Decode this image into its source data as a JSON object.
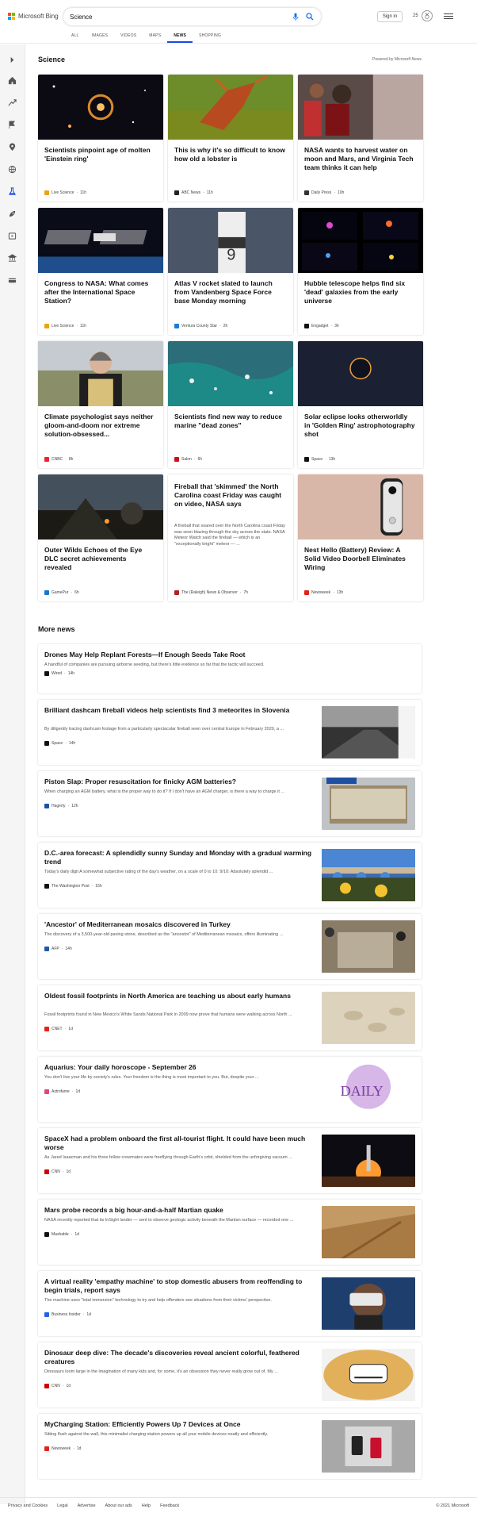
{
  "brand": {
    "logo_text": "Microsoft Bing",
    "logo_colors": [
      "#f25022",
      "#7fba00",
      "#00a4ef",
      "#ffb900"
    ]
  },
  "search": {
    "query": "Science",
    "mic_icon": "mic-icon",
    "search_icon": "search-icon"
  },
  "header": {
    "signin_label": "Sign in",
    "rewards_count": "25",
    "menu_icon": "hamburger-icon"
  },
  "tabs": [
    "ALL",
    "IMAGES",
    "VIDEOS",
    "MAPS",
    "NEWS",
    "SHOPPING"
  ],
  "active_tab": "NEWS",
  "accent": "#174ae4",
  "rail_icons": [
    "expand-icon",
    "home-icon",
    "trending-icon",
    "flag-icon",
    "location-icon",
    "globe-icon",
    "science-icon",
    "rocket-icon",
    "entertainment-icon",
    "bank-icon",
    "wallet-icon"
  ],
  "section": {
    "title": "Science",
    "powered_by": "Powered by Microsoft News"
  },
  "cards": [
    {
      "title": "Scientists pinpoint age of molten 'Einstein ring'",
      "snippet": "",
      "source": "Live Science",
      "time": "11h",
      "fav": "#e8a317",
      "img": "space"
    },
    {
      "title": "This is why it's so difficult to know how old a lobster is",
      "snippet": "",
      "source": "ABC News",
      "time": "11h",
      "fav": "#222",
      "img": "lobster"
    },
    {
      "title": "NASA wants to harvest water on moon and Mars, and Virginia Tech team thinks it can help",
      "snippet": "",
      "source": "Daily Press",
      "time": "10h",
      "fav": "#333",
      "img": "lab"
    },
    {
      "title": "Congress to NASA: What comes after the International Space Station?",
      "snippet": "",
      "source": "Live Science",
      "time": "11h",
      "fav": "#e8a317",
      "img": "iss"
    },
    {
      "title": "Atlas V rocket slated to launch from Vandenberg Space Force base Monday morning",
      "snippet": "",
      "source": "Ventura County Star",
      "time": "2h",
      "fav": "#1a7bd6",
      "img": "rocket"
    },
    {
      "title": "Hubble telescope helps find six 'dead' galaxies from the early universe",
      "snippet": "",
      "source": "Engadget",
      "time": "3h",
      "fav": "#111",
      "img": "galaxies"
    },
    {
      "title": "Climate psychologist says neither gloom-and-doom nor extreme solution-obsessed...",
      "snippet": "",
      "source": "CNBC",
      "time": "8h",
      "fav": "#e8262d",
      "img": "woman"
    },
    {
      "title": "Scientists find new way to reduce marine \"dead zones\"",
      "snippet": "",
      "source": "Salon",
      "time": "6h",
      "fav": "#c8101e",
      "img": "ocean"
    },
    {
      "title": "Solar eclipse looks otherworldly in 'Golden Ring' astrophotography shot",
      "snippet": "",
      "source": "Space",
      "time": "13h",
      "fav": "#111",
      "img": "eclipse"
    },
    {
      "title": "Outer Wilds Echoes of the Eye DLC secret achievements revealed",
      "snippet": "",
      "source": "GamePur",
      "time": "6h",
      "fav": "#1976d2",
      "img": "game"
    },
    {
      "title": "Fireball that 'skimmed' the North Carolina coast Friday was caught on video, NASA says",
      "snippet": "A fireball that soared over the North Carolina coast Friday was seen blazing through the sky across the state. NASA Meteor Watch said the fireball — which is an \"exceptionally bright\" meteor — ...",
      "source": "The (Raleigh) News & Observer",
      "time": "7h",
      "fav": "#b22222",
      "img": "none"
    },
    {
      "title": "Nest Hello (Battery) Review: A Solid Video Doorbell Eliminates Wiring",
      "snippet": "",
      "source": "Newsweek",
      "time": "13h",
      "fav": "#e2231a",
      "img": "doorbell"
    }
  ],
  "more": {
    "title": "More news"
  },
  "rows": [
    {
      "title": "Drones May Help Replant Forests—If Enough Seeds Take Root",
      "snippet": "A handful of companies are pursuing airborne seeding, but there's little evidence so far that the tactic will succeed.",
      "source": "Wired",
      "time": "14h",
      "fav": "#111",
      "thumb": "none"
    },
    {
      "title": "Brilliant dashcam fireball videos help scientists find 3 meteorites in Slovenia",
      "snippet": "By diligently tracing dashcam footage from a particularly spectacular fireball seen over central Europe in February 2020, a ...",
      "source": "Space",
      "time": "14h",
      "fav": "#111",
      "thumb": "dashcam"
    },
    {
      "title": "Piston Slap: Proper resuscitation for finicky AGM batteries?",
      "snippet": "When charging an AGM battery, what is the proper way to do it? If I don't have an AGM charger, is there a way to charge it ...",
      "source": "Hagerty",
      "time": "12h",
      "fav": "#1f4fa0",
      "thumb": "battery"
    },
    {
      "title": "D.C.-area forecast: A splendidly sunny Sunday and Monday with a gradual warming trend",
      "snippet": "Today's daily digit A somewhat subjective rating of the day's weather, on a scale of 0 to 10: 9/10: Absolutely splendid ...",
      "source": "The Washington Post",
      "time": "15h",
      "fav": "#111",
      "thumb": "bridge"
    },
    {
      "title": "'Ancestor' of Mediterranean mosaics discovered in Turkey",
      "snippet": "The discovery of a 3,500-year-old paving stone, described as the \"ancestor\" of Mediterranean mosaics, offers illuminating ...",
      "source": "AFP",
      "time": "14h",
      "fav": "#1e5aa8",
      "thumb": "mosaic"
    },
    {
      "title": "Oldest fossil footprints in North America are teaching us about early humans",
      "snippet": "Fossil footprints found in New Mexico's White Sands National Park in 2009 now prove that humans were walking across North ...",
      "source": "CNET",
      "time": "1d",
      "fav": "#e2231a",
      "thumb": "footprints"
    },
    {
      "title": "Aquarius: Your daily horoscope - September 26",
      "snippet": "You don't live your life by society's rules. Your freedom is the thing is most important to you. But, despite your ...",
      "source": "Astrofame",
      "time": "1d",
      "fav": "#e0457b",
      "thumb": "daily"
    },
    {
      "title": "SpaceX had a problem onboard the first all-tourist flight. It could have been much worse",
      "snippet": "As Jared Isaacman and his three fellow crewmates were freeflying through Earth's orbit, shielded from the unforgiving vacuum ...",
      "source": "CNN",
      "time": "1d",
      "fav": "#cc0000",
      "thumb": "launch"
    },
    {
      "title": "Mars probe records a big hour-and-a-half Martian quake",
      "snippet": "NASA recently reported that its InSight lander — sent to observe geologic activity beneath the Martian surface — recorded one ...",
      "source": "Mashable",
      "time": "1d",
      "fav": "#111",
      "thumb": "mars"
    },
    {
      "title": "A virtual reality 'empathy machine' to stop domestic abusers from reoffending to begin trials, report says",
      "snippet": "The machine uses \"total immersion\" technology to try and help offenders see situations from their victims' perspective.",
      "source": "Business Insider",
      "time": "1d",
      "fav": "#2563eb",
      "thumb": "vr"
    },
    {
      "title": "Dinosaur deep dive: The decade's discoveries reveal ancient colorful, feathered creatures",
      "snippet": "Dinosaurs loom large in the imagination of many kids and, for some, it's an obsession they never really grow out of. My ...",
      "source": "CNN",
      "time": "1d",
      "fav": "#cc0000",
      "thumb": "dino"
    },
    {
      "title": "MyCharging Station: Efficiently Powers Up 7 Devices at Once",
      "snippet": "Sitting flush against the wall, this minimalist charging station powers up all your mobile devices neatly and efficiently.",
      "source": "Newsweek",
      "time": "1d",
      "fav": "#e2231a",
      "thumb": "charger"
    }
  ],
  "footer": {
    "links": [
      "Privacy and Cookies",
      "Legal",
      "Advertise",
      "About our ads",
      "Help",
      "Feedback"
    ],
    "copyright": "© 2021 Microsoft"
  }
}
